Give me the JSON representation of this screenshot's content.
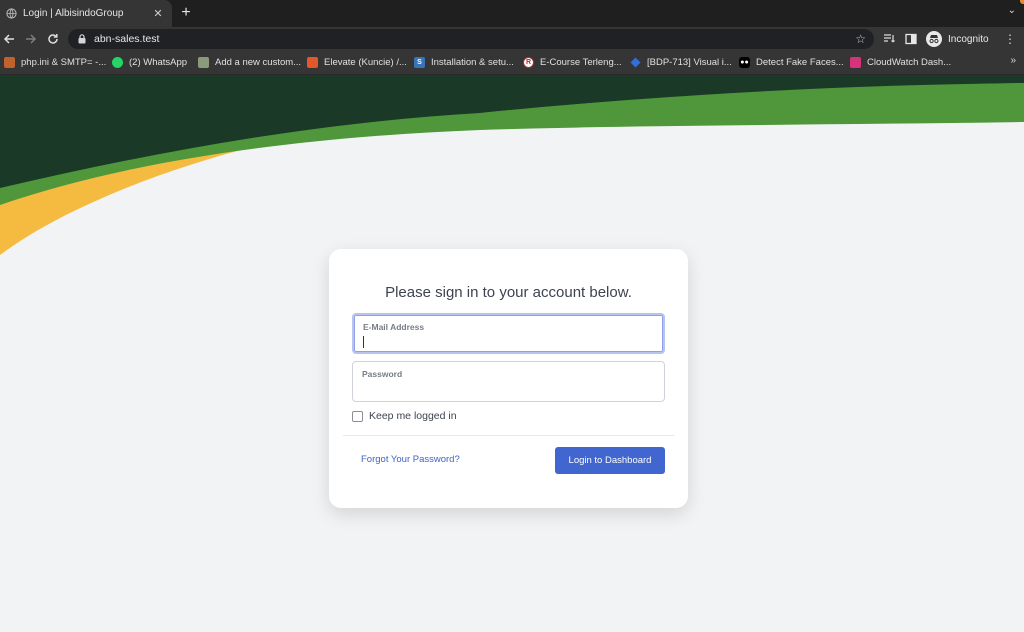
{
  "browser": {
    "tab_title": "Login | AlbisindoGroup",
    "tab_close": "✕",
    "new_tab": "+",
    "tab_search": "⌄",
    "url": "abn-sales.test",
    "profile_label": "Incognito",
    "bookmarks": [
      {
        "label": "php.ini & SMTP= -...",
        "icon": "php-icon",
        "color": "#c0622b"
      },
      {
        "label": "(2) WhatsApp",
        "icon": "whatsapp-icon",
        "color": "#25d366"
      },
      {
        "label": "Add a new custom...",
        "icon": "page-thumb-icon",
        "color": "#8a9a7a"
      },
      {
        "label": "Elevate (Kuncie) /...",
        "icon": "gitlab-icon",
        "color": "#e2572b"
      },
      {
        "label": "Installation & setu...",
        "icon": "s-icon",
        "color": "#3a72b6"
      },
      {
        "label": "E-Course Terleng...",
        "icon": "r-circle-icon",
        "color": "#b03030"
      },
      {
        "label": "[BDP-713] Visual i...",
        "icon": "jira-icon",
        "color": "#2f6fe0"
      },
      {
        "label": "Detect Fake Faces...",
        "icon": "dots-icon",
        "color": "#000000"
      },
      {
        "label": "CloudWatch Dash...",
        "icon": "cloudwatch-icon",
        "color": "#d6337a"
      }
    ],
    "bookmarks_more": "»"
  },
  "login": {
    "heading": "Please sign in to your account below.",
    "email_label": "E-Mail Address",
    "email_value": "",
    "password_label": "Password",
    "password_value": "",
    "remember_label": "Keep me logged in",
    "remember_checked": false,
    "forgot_label": "Forgot Your Password?",
    "submit_label": "Login to Dashboard"
  },
  "colors": {
    "primary_button": "#4266cf",
    "link": "#3f63c6",
    "wave_dark_green": "#1a3a27",
    "wave_green": "#4f973a",
    "wave_yellow": "#f4bb40",
    "page_bg": "#f2f3f5"
  }
}
